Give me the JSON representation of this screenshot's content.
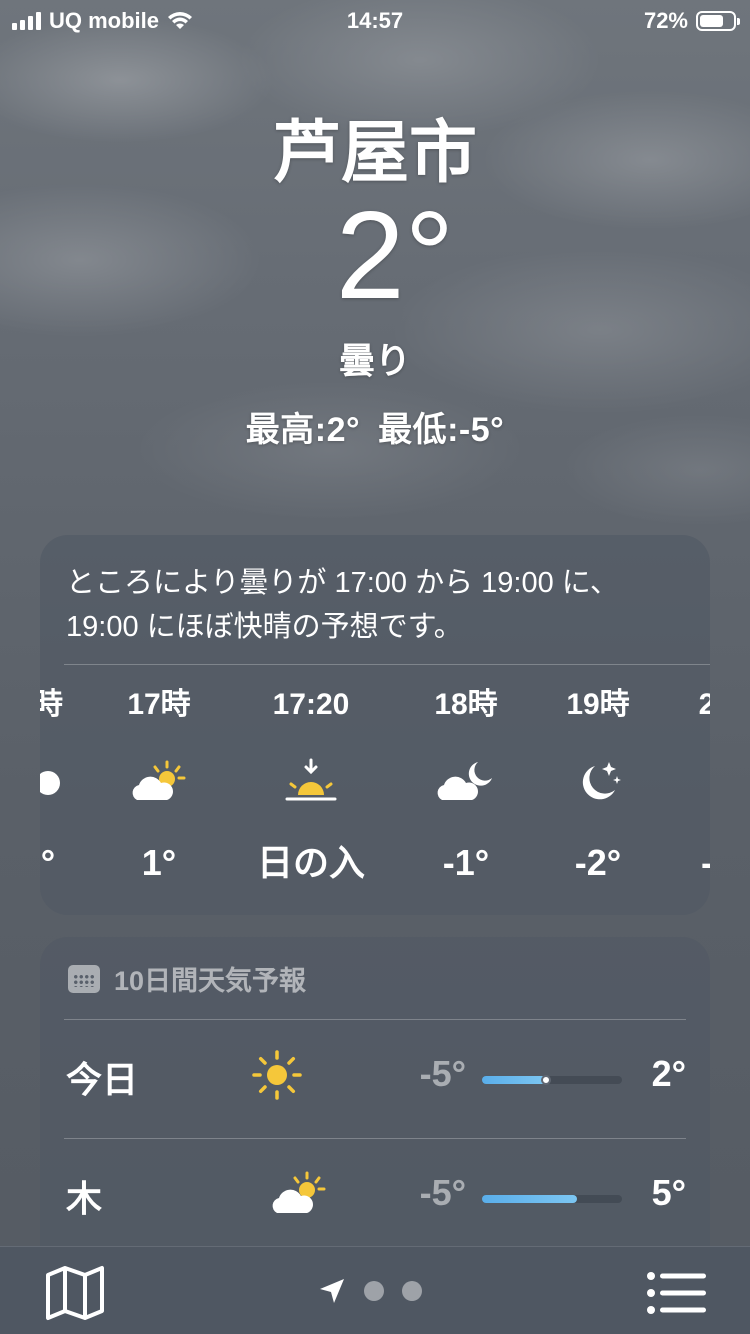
{
  "status_bar": {
    "carrier": "UQ mobile",
    "time": "14:57",
    "battery": "72%",
    "battery_level": 0.72
  },
  "location": {
    "city": "芦屋市",
    "temperature": "2°",
    "condition": "曇り",
    "high": "最高:2°",
    "low": "最低:-5°"
  },
  "hourly": {
    "summary": "ところにより曇りが 17:00 から 19:00 に、19:00 にほぼ快晴の予想です。",
    "items": [
      {
        "time": "時",
        "icon": "partial-moon-icon",
        "temp": "°"
      },
      {
        "time": "17時",
        "icon": "partly-cloudy-day-icon",
        "temp": "1°"
      },
      {
        "time": "17:20",
        "icon": "sunset-icon",
        "temp": "日の入"
      },
      {
        "time": "18時",
        "icon": "partly-cloudy-night-icon",
        "temp": "-1°"
      },
      {
        "time": "19時",
        "icon": "clear-night-icon",
        "temp": "-2°"
      },
      {
        "time": "2",
        "icon": "",
        "temp": "-"
      }
    ]
  },
  "daily": {
    "header": "10日間天気予報",
    "header_icon": "calendar-icon",
    "days": [
      {
        "name": "今日",
        "icon": "sun-icon",
        "low": "-5°",
        "high": "2°",
        "range_start": 0.0,
        "range_end": 0.46,
        "current": 0.46
      },
      {
        "name": "木",
        "icon": "partly-cloudy-day-icon",
        "low": "-5°",
        "high": "5°",
        "range_start": 0.0,
        "range_end": 0.68
      }
    ]
  },
  "toolbar": {
    "map_icon": "map-icon",
    "location_icon": "location-arrow-icon",
    "list_icon": "list-icon",
    "pages": 3
  },
  "colors": {
    "sun": "#f5c73a",
    "bar": "#5aaeea"
  }
}
